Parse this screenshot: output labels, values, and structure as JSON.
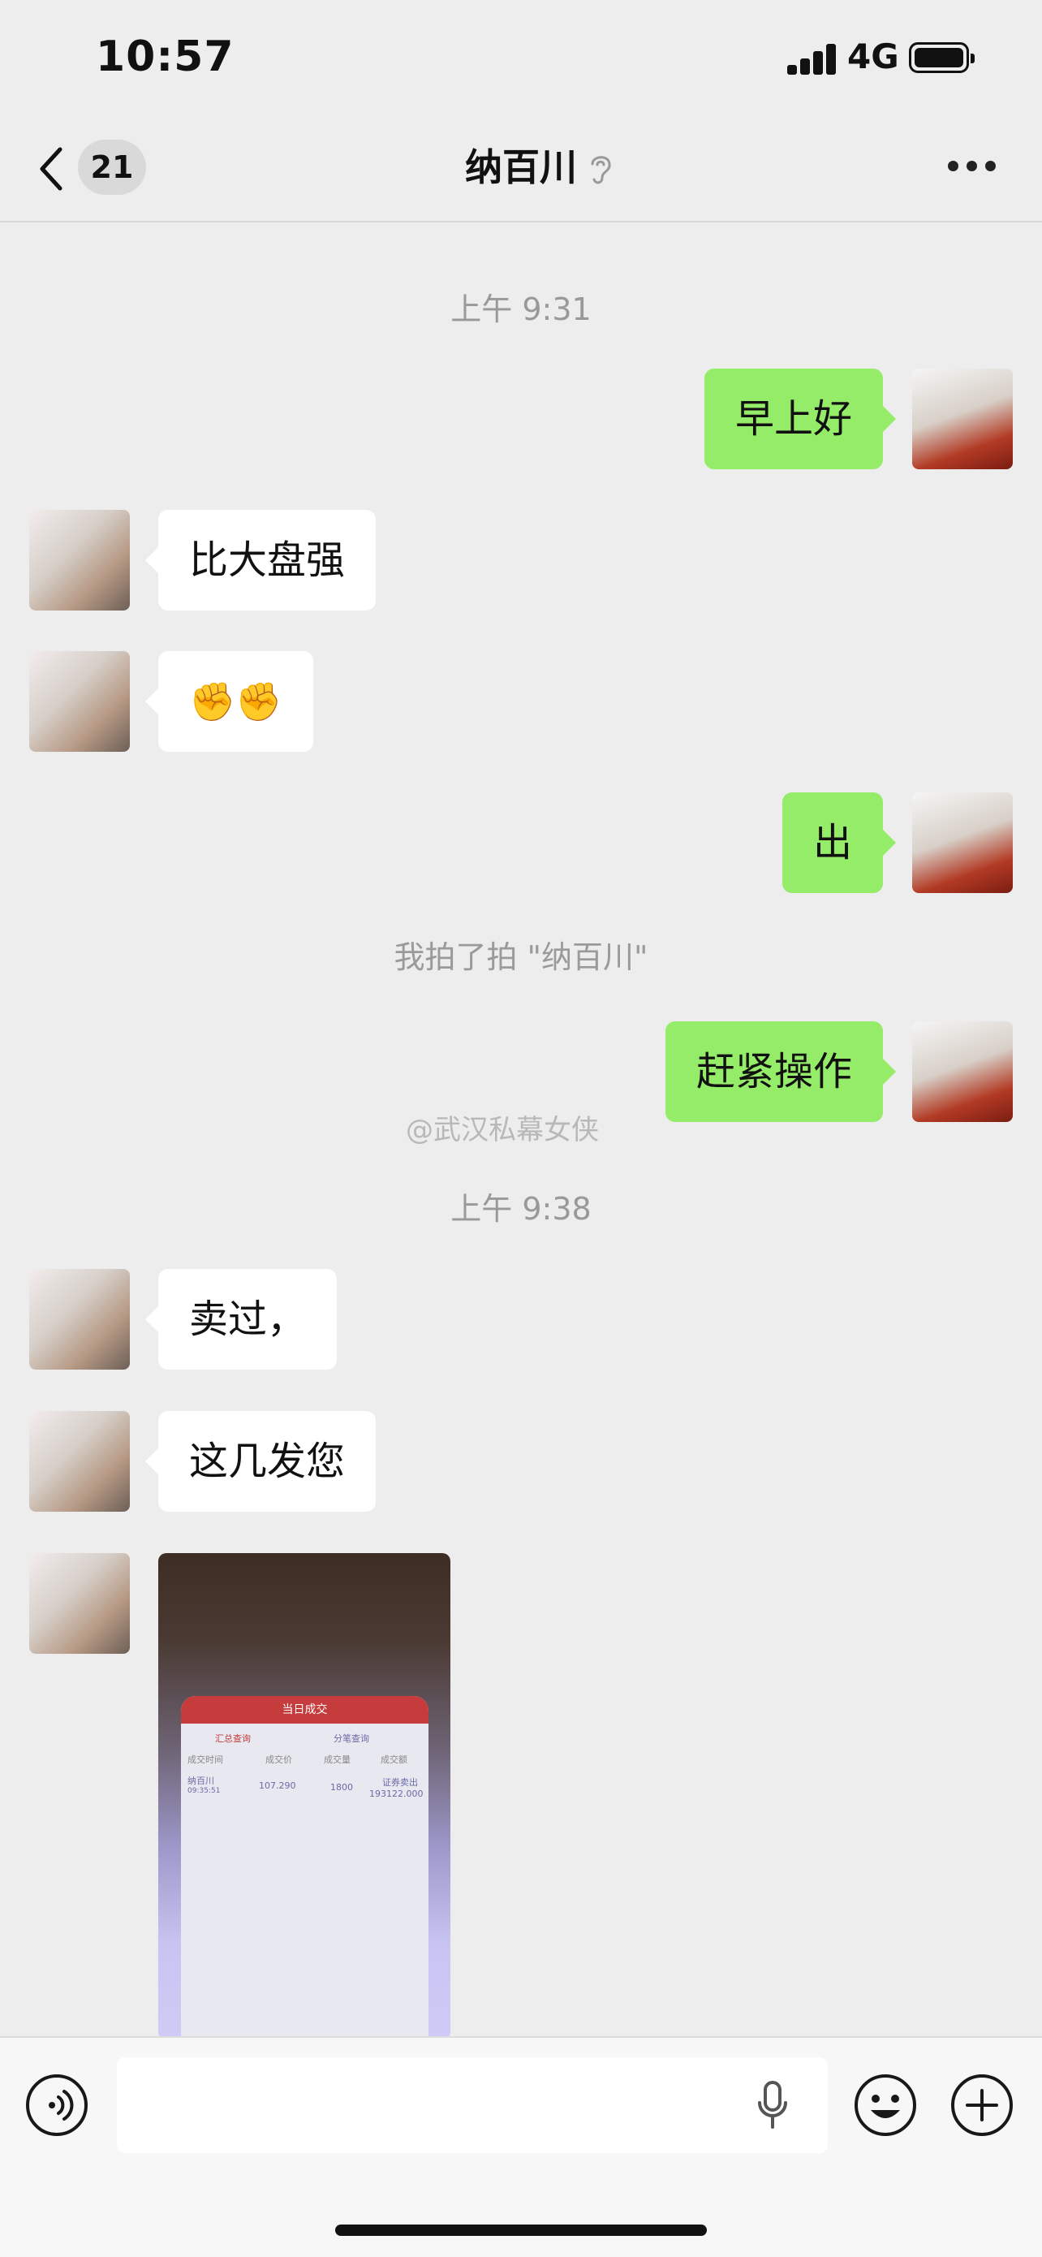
{
  "status_bar": {
    "time": "10:57",
    "network": "4G"
  },
  "nav": {
    "back_count": "21",
    "title": "纳百川"
  },
  "messages": [
    {
      "type": "time",
      "text": "上午 9:31"
    },
    {
      "type": "sent",
      "text": "早上好"
    },
    {
      "type": "received",
      "text": "比大盘强"
    },
    {
      "type": "received",
      "text": "✊✊"
    },
    {
      "type": "sent",
      "text": "出"
    },
    {
      "type": "system",
      "text": "我拍了拍 \"纳百川\""
    },
    {
      "type": "sent",
      "text": "赶紧操作"
    },
    {
      "type": "time",
      "text": "上午 9:38"
    },
    {
      "type": "received",
      "text": "卖过，"
    },
    {
      "type": "received",
      "text": "这几发您"
    },
    {
      "type": "received_image",
      "text": ""
    }
  ],
  "watermark": "@武汉私幕女侠",
  "photo_content": {
    "header": "当日成交",
    "tab_left": "汇总查询",
    "tab_right": "分笔查询",
    "col_time": "成交时间",
    "col_price": "成交价",
    "col_volume": "成交量",
    "col_amount": "成交额",
    "row_name": "纳百川",
    "row_time": "09:35:51",
    "row_price": "107.290",
    "row_volume": "1800",
    "row_type": "证券卖出",
    "row_amount": "193122.000"
  },
  "icons": {
    "back": "chevron-left-icon",
    "ear": "ear-icon",
    "more": "more-dots-icon",
    "voice": "voice-input-icon",
    "mic": "microphone-icon",
    "emoji": "emoji-icon",
    "plus": "plus-circle-icon"
  },
  "colors": {
    "sent_bubble": "#95ec69",
    "received_bubble": "#ffffff",
    "background": "#ededed"
  }
}
